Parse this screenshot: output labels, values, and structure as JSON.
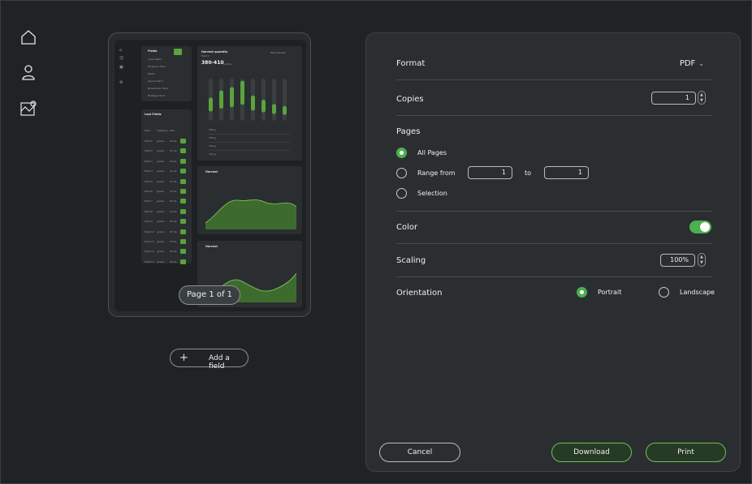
{
  "nav": {
    "items": [
      {
        "name": "home-icon"
      },
      {
        "name": "user-icon"
      },
      {
        "name": "field-map-icon"
      }
    ]
  },
  "preview": {
    "page_label": "Page 1 of 1",
    "fields_title": "Fields",
    "list_items": [
      "Luna Fields",
      "Ferguson Farm",
      "Fields",
      "Jessica Farm",
      "Broadmoor Farm",
      "Ballinger Farm"
    ],
    "table_title": "Last Fields",
    "table_headers": [
      "Field",
      "Category",
      "Size"
    ],
    "table_rows": [
      [
        "Field 1",
        "grains",
        "24 ha"
      ],
      [
        "Field 2",
        "grains",
        "31 ha"
      ],
      [
        "Field 3",
        "grains",
        "18 ha"
      ],
      [
        "Field 4",
        "grains",
        "22 ha"
      ],
      [
        "Field 5",
        "grains",
        "27 ha"
      ],
      [
        "Field 6",
        "grains",
        "19 ha"
      ],
      [
        "Field 7",
        "grains",
        "29 ha"
      ],
      [
        "Field 8",
        "grains",
        "16 ha"
      ],
      [
        "Field 9",
        "grains",
        "25 ha"
      ],
      [
        "Field 10",
        "grains",
        "21 ha"
      ],
      [
        "Field 11",
        "grains",
        "33 ha"
      ],
      [
        "Field 12",
        "grains",
        "20 ha"
      ],
      [
        "Field 13",
        "grains",
        "28 ha"
      ]
    ],
    "yield_title": "Harvest quantity",
    "yield_sub": "Field 1",
    "yield_value": "380-410",
    "yield_unit": "ton/ha",
    "yield_badge": "Past harvest",
    "bars": [
      0.55,
      0.72,
      0.8,
      0.95,
      0.6,
      0.5,
      0.4,
      0.35
    ],
    "yield_rows": [
      "380 g",
      "330 g",
      "320 g",
      "310 g"
    ],
    "chart2_title": "Harvest",
    "chart3_title": "Harvest"
  },
  "add_field_label": "Add a field",
  "panel": {
    "format": {
      "label": "Format",
      "value": "PDF"
    },
    "copies": {
      "label": "Copies",
      "value": "1"
    },
    "pages": {
      "label": "Pages",
      "all_pages": "All Pages",
      "range_from": "Range from",
      "range_start": "1",
      "to_label": "to",
      "range_end": "1",
      "selection": "Selection",
      "selected": "all"
    },
    "color": {
      "label": "Color",
      "enabled": true
    },
    "scaling": {
      "label": "Scaling",
      "value": "100%"
    },
    "orientation": {
      "label": "Orientation",
      "portrait": "Portrait",
      "landscape": "Landscape",
      "selected": "portrait"
    },
    "buttons": {
      "cancel": "Cancel",
      "download": "Download",
      "print": "Print"
    }
  },
  "colors": {
    "accent": "#4caf50",
    "background": "#1f2325",
    "panel": "#2a2e31"
  }
}
